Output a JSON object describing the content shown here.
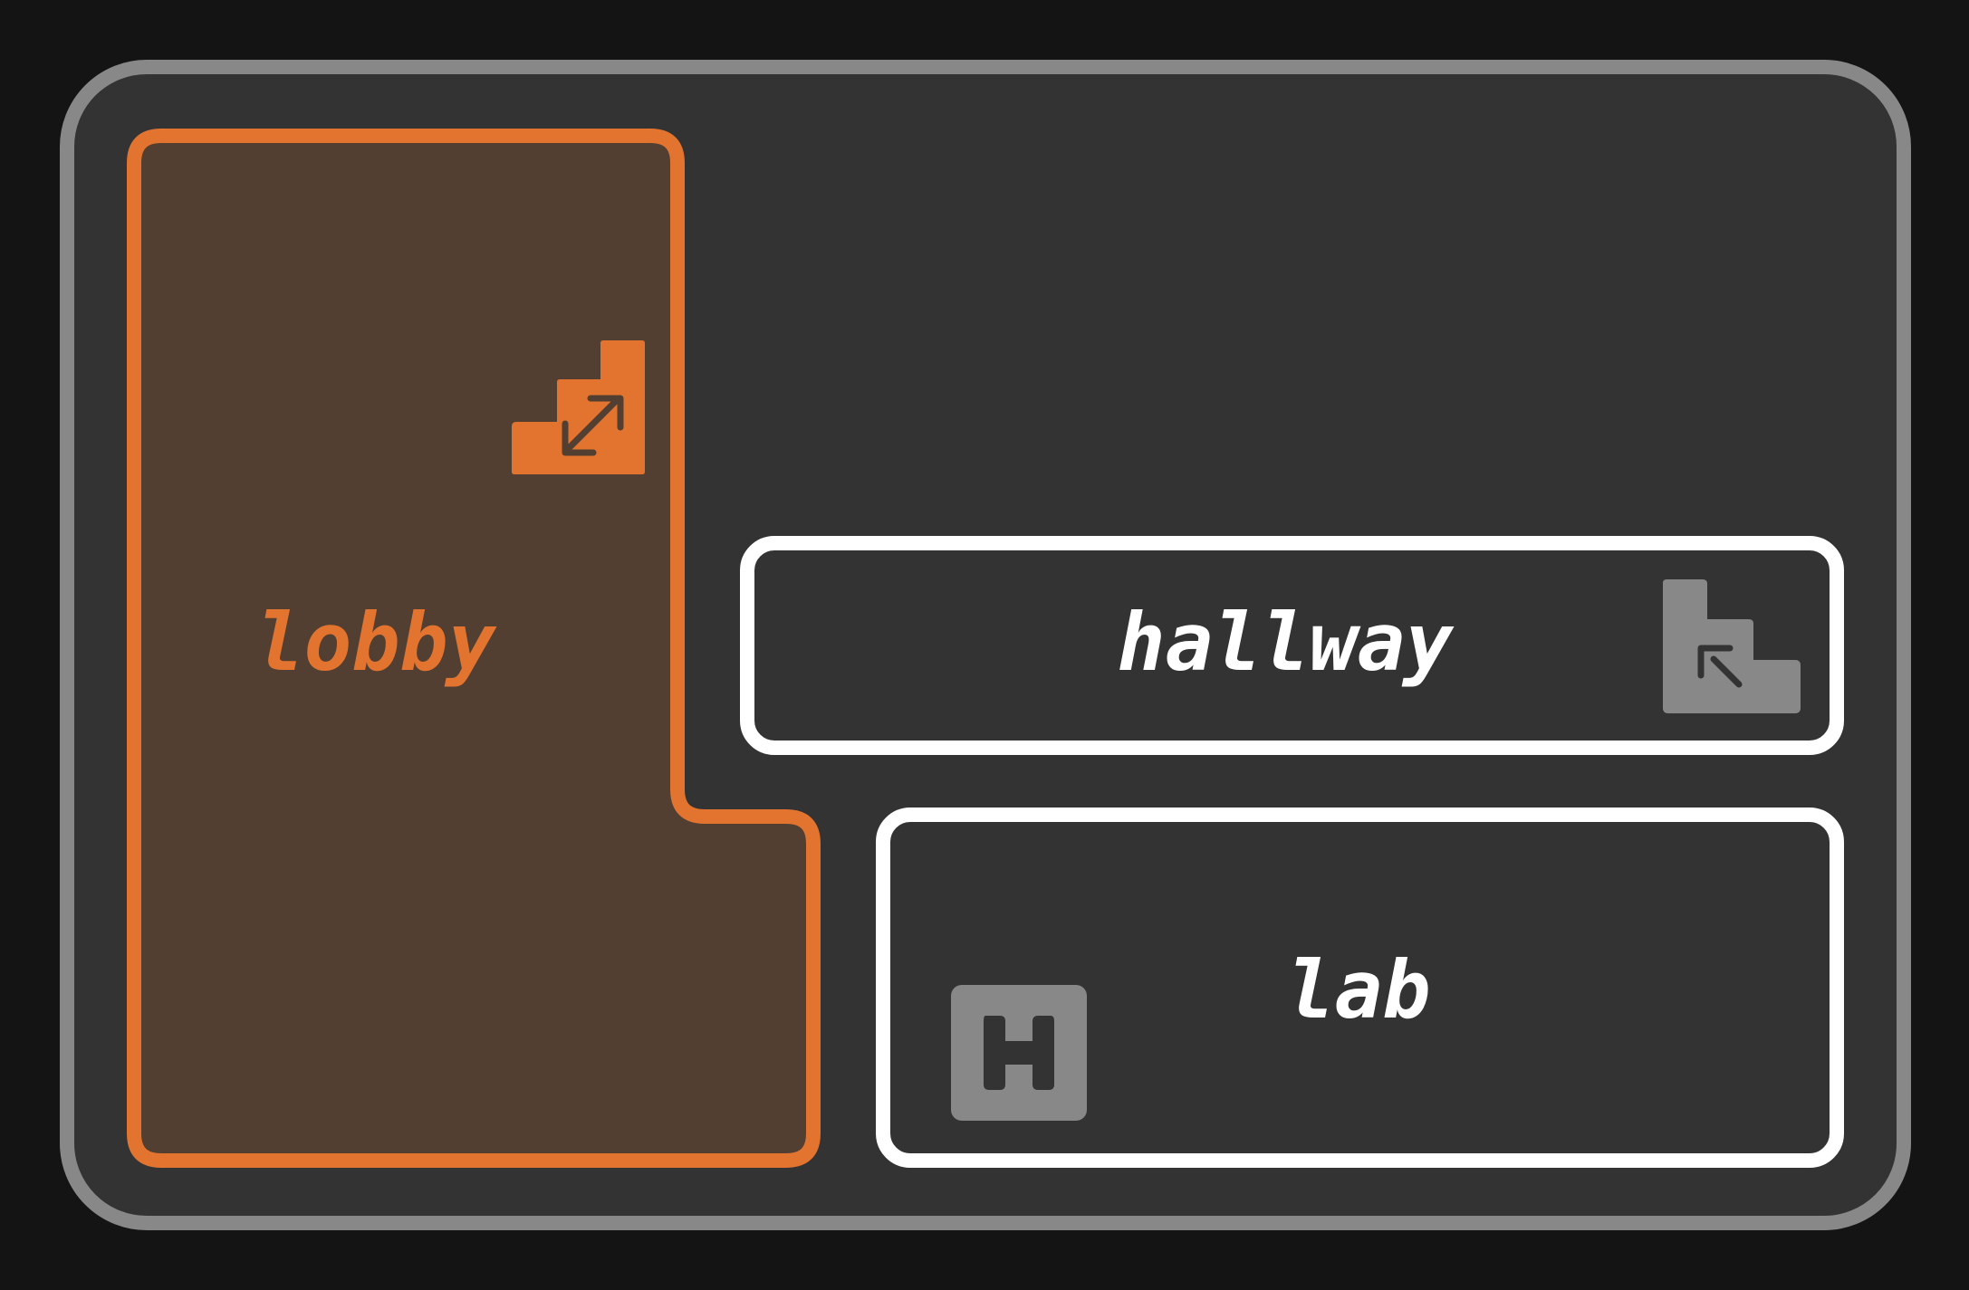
{
  "floor": {
    "colors": {
      "page_background": "#141414",
      "panel_fill": "#333333",
      "panel_border": "#888888",
      "selected_border": "#e2742f",
      "selected_fill": "#523f31",
      "room_border": "#ffffff",
      "room_fill": "#333333",
      "inactive_icon": "#888888"
    },
    "rooms": [
      {
        "id": "lobby",
        "label": "lobby",
        "selected": true,
        "icon": "stairs-up-down-icon"
      },
      {
        "id": "hallway",
        "label": "hallway",
        "selected": false,
        "icon": "stairs-down-icon"
      },
      {
        "id": "lab",
        "label": "lab",
        "selected": false,
        "icon": "helipad-icon"
      }
    ]
  }
}
